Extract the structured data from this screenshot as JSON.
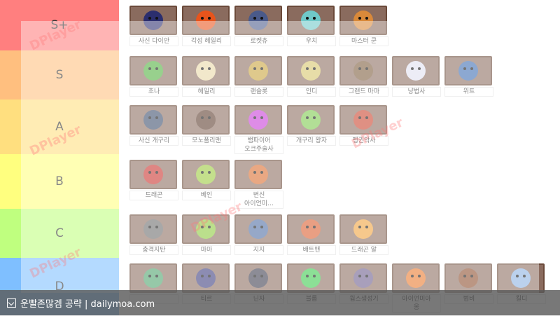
{
  "colors": {
    "S+": "#ff7f7f",
    "S": "#ffbf7f",
    "A": "#ffdf7f",
    "B": "#ffff7f",
    "C": "#bfff7f",
    "D": "#7fbfff"
  },
  "tiers": [
    {
      "label": "S+",
      "items": [
        {
          "name": "사신 다이안",
          "icon": "reaper-dian-icon",
          "color": "#2b2e6e"
        },
        {
          "name": "각성 헤일리",
          "icon": "awakened-haley-icon",
          "color": "#e8541c"
        },
        {
          "name": "로켓츄",
          "icon": "rocket-chu-icon",
          "color": "#4a5a8a"
        },
        {
          "name": "우치",
          "icon": "woochi-icon",
          "color": "#6fc9c9"
        },
        {
          "name": "마스터 쿤",
          "icon": "master-kun-icon",
          "color": "#d9893a"
        }
      ]
    },
    {
      "label": "S",
      "items": [
        {
          "name": "초나",
          "icon": "chona-icon",
          "color": "#4fae3b"
        },
        {
          "name": "헤일리",
          "icon": "haley-icon",
          "color": "#e9d8a6"
        },
        {
          "name": "랜슬롯",
          "icon": "lancelot-icon",
          "color": "#c9a33a"
        },
        {
          "name": "인디",
          "icon": "indy-icon",
          "color": "#d6c46a"
        },
        {
          "name": "그랜드 마마",
          "icon": "grand-mama-icon",
          "color": "#7a5a3a"
        },
        {
          "name": "냥법사",
          "icon": "cat-wizard-icon",
          "color": "#e0e0f0"
        },
        {
          "name": "위트",
          "icon": "wit-icon",
          "color": "#3a6ab0"
        }
      ]
    },
    {
      "label": "A",
      "items": [
        {
          "name": "사신 개구리",
          "icon": "reaper-frog-icon",
          "color": "#3a4a6a"
        },
        {
          "name": "모노폴리맨",
          "icon": "monopoly-man-icon",
          "color": "#5a3a2a"
        },
        {
          "name": "뱀파이어\n오크주술사",
          "icon": "vampire-orc-shaman-icon",
          "color": "#c63ad6"
        },
        {
          "name": "개구리 왕자",
          "icon": "frog-prince-icon",
          "color": "#7ac94a"
        },
        {
          "name": "펭귄악사",
          "icon": "penguin-musician-icon",
          "color": "#c9402a"
        }
      ]
    },
    {
      "label": "B",
      "items": [
        {
          "name": "드래곤",
          "icon": "dragon-icon",
          "color": "#c9302a"
        },
        {
          "name": "베인",
          "icon": "bane-icon",
          "color": "#9ac93a"
        },
        {
          "name": "변신\n아이언미…",
          "icon": "transformed-iron-meow-icon",
          "color": "#d96a2a"
        }
      ]
    },
    {
      "label": "C",
      "items": [
        {
          "name": "충격지탄",
          "icon": "shock-cannon-icon",
          "color": "#6a6a6a"
        },
        {
          "name": "마마",
          "icon": "mama-icon",
          "color": "#8ac93a"
        },
        {
          "name": "지지",
          "icon": "gigi-icon",
          "color": "#4a6aa0"
        },
        {
          "name": "배트맨",
          "icon": "batman-icon",
          "color": "#d95a2a"
        },
        {
          "name": "드래곤 알",
          "icon": "dragon-egg-icon",
          "color": "#f0a03a"
        }
      ]
    },
    {
      "label": "D",
      "items": [
        {
          "name": "",
          "icon": "staff-goblin-icon",
          "color": "#4aa06a"
        },
        {
          "name": "티르",
          "icon": "tyr-icon",
          "color": "#3a3a7a"
        },
        {
          "name": "닌자",
          "icon": "ninja-icon",
          "color": "#3a3a4a"
        },
        {
          "name": "블롭",
          "icon": "blob-icon",
          "color": "#3ac94a"
        },
        {
          "name": "웜스생성기",
          "icon": "worm-generator-icon",
          "color": "#6a5a8a"
        },
        {
          "name": "아이언미아\n옹",
          "icon": "iron-meow-icon",
          "color": "#e8782a"
        },
        {
          "name": "범비",
          "icon": "bumbi-icon",
          "color": "#8a4a2a"
        },
        {
          "name": "킬디",
          "icon": "kildi-icon",
          "color": "#8ab0e0"
        }
      ]
    }
  ],
  "watermarks": [
    "DPlayer",
    "DPlayer",
    "DPlayer",
    "DPlayer",
    "DPlayer"
  ],
  "footer": {
    "icon": "image-icon",
    "text": "운빨존많겜 공략 | dailymoa.com"
  }
}
